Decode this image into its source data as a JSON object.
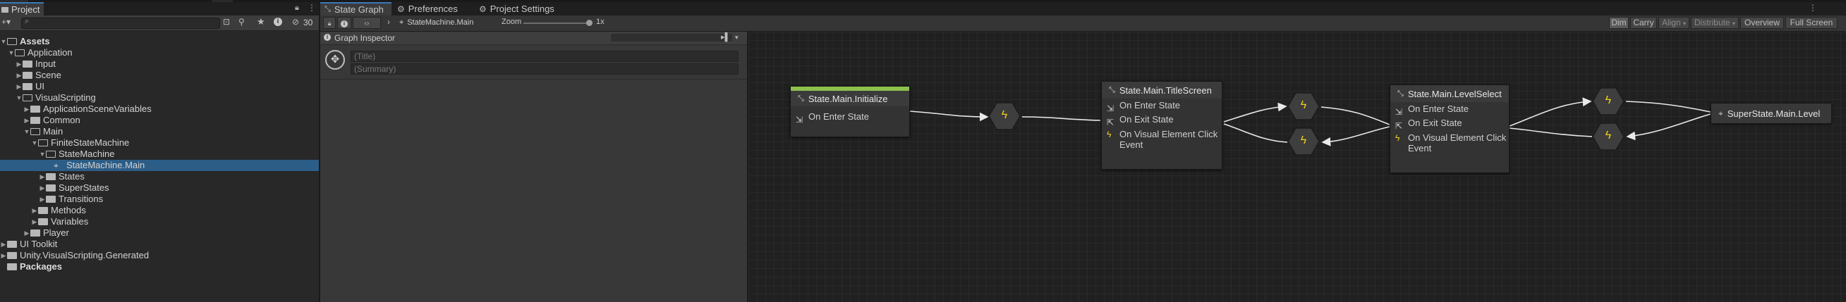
{
  "project": {
    "tab_label": "Project",
    "hidden_count": "30",
    "tree": [
      {
        "label": "Assets",
        "level": 0,
        "arrow": "open",
        "kind": "folder-open",
        "bold": true
      },
      {
        "label": "Application",
        "level": 1,
        "arrow": "open",
        "kind": "folder-open"
      },
      {
        "label": "Input",
        "level": 2,
        "arrow": "closed",
        "kind": "folder"
      },
      {
        "label": "Scene",
        "level": 2,
        "arrow": "closed",
        "kind": "folder"
      },
      {
        "label": "UI",
        "level": 2,
        "arrow": "closed",
        "kind": "folder"
      },
      {
        "label": "VisualScripting",
        "level": 2,
        "arrow": "open",
        "kind": "folder-open"
      },
      {
        "label": "ApplicationSceneVariables",
        "level": 3,
        "arrow": "closed",
        "kind": "folder"
      },
      {
        "label": "Common",
        "level": 3,
        "arrow": "closed",
        "kind": "folder"
      },
      {
        "label": "Main",
        "level": 3,
        "arrow": "open",
        "kind": "folder-open"
      },
      {
        "label": "FiniteStateMachine",
        "level": 4,
        "arrow": "open",
        "kind": "folder-open"
      },
      {
        "label": "StateMachine",
        "level": 5,
        "arrow": "open",
        "kind": "folder-open"
      },
      {
        "label": "StateMachine.Main",
        "level": 6,
        "arrow": "none",
        "kind": "graph",
        "selected": true
      },
      {
        "label": "States",
        "level": 5,
        "arrow": "closed",
        "kind": "folder"
      },
      {
        "label": "SuperStates",
        "level": 5,
        "arrow": "closed",
        "kind": "folder"
      },
      {
        "label": "Transitions",
        "level": 5,
        "arrow": "closed",
        "kind": "folder"
      },
      {
        "label": "Methods",
        "level": 4,
        "arrow": "closed",
        "kind": "folder"
      },
      {
        "label": "Variables",
        "level": 4,
        "arrow": "closed",
        "kind": "folder"
      },
      {
        "label": "Player",
        "level": 3,
        "arrow": "closed",
        "kind": "folder"
      },
      {
        "label": "UI Toolkit",
        "level": 0,
        "arrow": "closed",
        "kind": "folder"
      },
      {
        "label": "Unity.VisualScripting.Generated",
        "level": 0,
        "arrow": "closed",
        "kind": "folder"
      },
      {
        "label": "Packages",
        "level": 0,
        "arrow": "none",
        "kind": "folder",
        "bold": true
      }
    ]
  },
  "graph_window": {
    "tabs": [
      "State Graph",
      "Preferences",
      "Project Settings"
    ],
    "breadcrumb": "StateMachine.Main",
    "zoom_label": "Zoom",
    "zoom_value": "1x",
    "zoom_fraction": 0.97,
    "right_buttons": [
      "Dim",
      "Carry",
      "Align",
      "Distribute",
      "Overview",
      "Full Screen"
    ],
    "inspector": {
      "title": "Graph Inspector",
      "title_placeholder": "(Title)",
      "summary_placeholder": "(Summary)"
    }
  },
  "nodes": {
    "initialize": {
      "title": "State.Main.Initialize",
      "events": [
        "On Enter State"
      ]
    },
    "titlescreen": {
      "title": "State.Main.TitleScreen",
      "events": [
        "On Enter State",
        "On Exit State"
      ],
      "trigger": "On Visual Element Click Event"
    },
    "levelselect": {
      "title": "State.Main.LevelSelect",
      "events": [
        "On Enter State",
        "On Exit State"
      ],
      "trigger": "On Visual Element Click Event"
    },
    "superlevel": {
      "title": "SuperState.Main.Level"
    }
  },
  "colors": {
    "start_bar": "#8ec14d",
    "selection": "#2c5d87",
    "accent": "#3a79bb",
    "transition_bolt": "#f2d01b"
  }
}
